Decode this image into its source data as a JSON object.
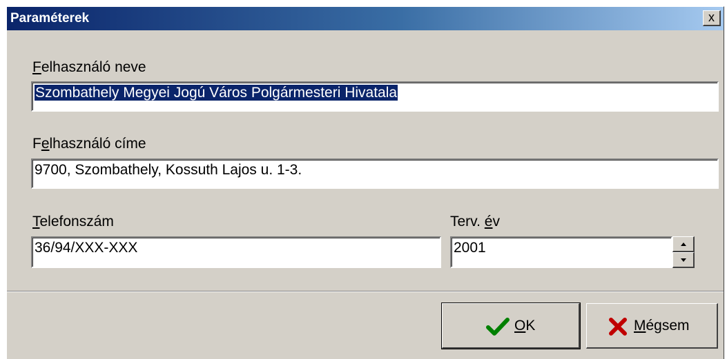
{
  "window": {
    "title": "Paraméterek",
    "close_label": "x"
  },
  "form": {
    "user_name": {
      "label_accel": "F",
      "label_rest": "elhasználó neve",
      "value": "Szombathely Megyei Jogú Város Polgármesteri Hivatala"
    },
    "user_address": {
      "label_pre": "F",
      "label_accel": "e",
      "label_rest": "lhasználó címe",
      "value": "9700, Szombathely, Kossuth Lajos u. 1-3."
    },
    "phone": {
      "label_accel": "T",
      "label_rest": "elefonszám",
      "value": "36/94/XXX-XXX"
    },
    "plan_year": {
      "label_pre": "Terv. ",
      "label_accel": "é",
      "label_rest": "v",
      "value": "2001"
    }
  },
  "buttons": {
    "ok": {
      "accel": "O",
      "rest": "K",
      "icon": "check-icon",
      "icon_color": "#008000"
    },
    "cancel": {
      "accel": "M",
      "rest": "égsem",
      "icon": "cross-icon",
      "icon_color": "#c00000"
    }
  },
  "colors": {
    "titlebar_start": "#0a246a",
    "titlebar_end": "#a6caf0",
    "face": "#d4d0c8",
    "selection": "#0a246a"
  }
}
